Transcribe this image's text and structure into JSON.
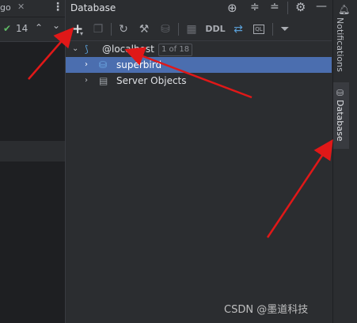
{
  "left": {
    "tab_fragment": "go",
    "inspection_count": "14",
    "check_icon": "check-icon",
    "up_icon": "arrow-up-icon",
    "down_icon": "arrow-down-icon"
  },
  "panel": {
    "title": "Database",
    "header_icons": [
      "crosshair-icon",
      "expand-all-icon",
      "collapse-all-icon",
      "gear-icon",
      "minimize-icon"
    ]
  },
  "toolbar": {
    "ddl_label": "DDL",
    "ql_label": "QL"
  },
  "tree": {
    "root_label": "@localhost",
    "root_badge": "1 of 18",
    "children": [
      {
        "label": "superbird",
        "selected": true
      },
      {
        "label": "Server Objects",
        "selected": false
      }
    ]
  },
  "right_stripe": {
    "notifications_label": "Notifications",
    "database_label": "Database"
  },
  "watermark": "CSDN @墨道科技",
  "colors": {
    "selection": "#4b6eaf",
    "annotation_arrow": "#e01818",
    "panel_bg": "#2b2d30",
    "editor_bg": "#1e1f22"
  }
}
